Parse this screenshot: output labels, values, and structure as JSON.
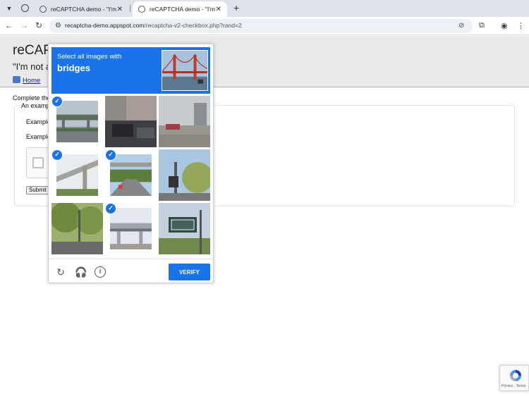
{
  "browser": {
    "tabs": [
      {
        "title": "reCAPTCHA demo - \"I'm not a robot\"",
        "active": false
      },
      {
        "title": "reCAPTCHA demo - \"I'm not a robot\"",
        "active": true
      }
    ],
    "url_host": "recaptcha-demo.appspot.com",
    "url_path": "/recaptcha-v2-checkbox.php?rand=2",
    "icons": {
      "menu": "chevron-down-icon",
      "back": "back-arrow-icon",
      "forward": "forward-arrow-icon",
      "reload": "reload-icon",
      "site_info": "tune-icon",
      "tracking": "eye-off-icon",
      "extensions": "puzzle-icon",
      "profile": "profile-icon",
      "more": "kebab-icon"
    }
  },
  "page": {
    "title": "reCAPTCHA demo",
    "subtitle": "\"I'm not a robot\"",
    "home_link": "Home",
    "complete_text": "Complete the reCAPTCHA then submit the form.",
    "fieldset_legend": "An example form",
    "line1": "Example input A:",
    "line2": "Example input B:",
    "submit_label": "Submit"
  },
  "challenge": {
    "prompt": "Select all images with",
    "keyword": "bridges",
    "cells": [
      {
        "selected": true
      },
      {
        "selected": false
      },
      {
        "selected": false
      },
      {
        "selected": true
      },
      {
        "selected": true
      },
      {
        "selected": false
      },
      {
        "selected": false
      },
      {
        "selected": true
      },
      {
        "selected": false
      }
    ],
    "verify_label": "VERIFY",
    "icons": {
      "reload": "reload-icon",
      "audio": "headphones-icon",
      "info": "info-icon"
    }
  },
  "badge": {
    "links": "Privacy - Terms"
  },
  "colors": {
    "accent": "#1a73e8",
    "tabbar": "#dee3eb",
    "header_bg": "#e9e9ec"
  }
}
